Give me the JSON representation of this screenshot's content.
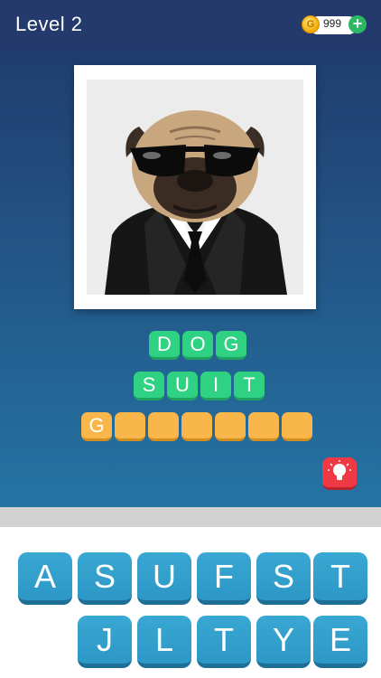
{
  "header": {
    "level_label": "Level 2",
    "coin_count": "999",
    "coin_symbol": "G",
    "add_symbol": "+"
  },
  "puzzle": {
    "image_subject": "pug in sunglasses and suit",
    "clue_words": [
      [
        "D",
        "O",
        "G"
      ],
      [
        "S",
        "U",
        "I",
        "T"
      ]
    ],
    "answer_slots": [
      "G",
      "",
      "",
      "",
      "",
      "",
      ""
    ]
  },
  "keyboard": {
    "row1": [
      "A",
      "S",
      "U",
      "F",
      "S",
      "T"
    ],
    "row2": [
      "J",
      "L",
      "T",
      "Y",
      "E"
    ]
  },
  "colors": {
    "header": "#243a6c",
    "clue_tile": "#2fd283",
    "answer_tile": "#f9b64a",
    "key": "#2d97c5",
    "hint": "#ef3a46"
  }
}
